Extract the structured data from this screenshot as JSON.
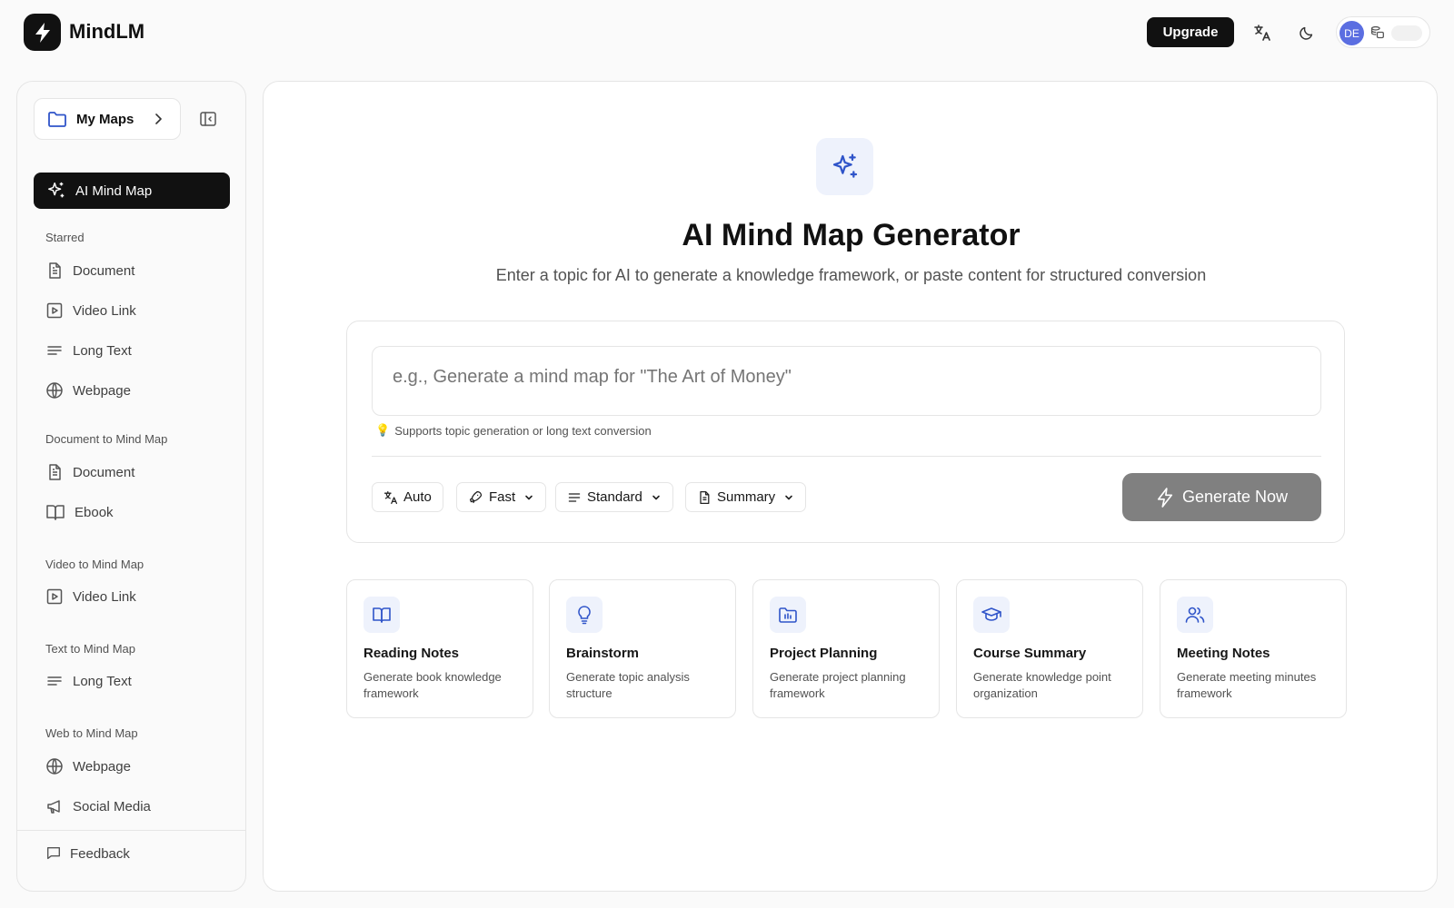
{
  "header": {
    "brand": "MindLM",
    "upgrade_label": "Upgrade",
    "avatar_initials": "DE"
  },
  "sidebar": {
    "my_maps_label": "My Maps",
    "active_item": "AI Mind Map",
    "sections": [
      {
        "label": "Starred",
        "items": [
          {
            "label": "Document",
            "icon": "document-icon"
          },
          {
            "label": "Video Link",
            "icon": "video-icon"
          },
          {
            "label": "Long Text",
            "icon": "text-lines-icon"
          },
          {
            "label": "Webpage",
            "icon": "globe-icon"
          }
        ]
      },
      {
        "label": "Document to Mind Map",
        "items": [
          {
            "label": "Document",
            "icon": "document-icon"
          },
          {
            "label": "Ebook",
            "icon": "book-icon"
          }
        ]
      },
      {
        "label": "Video to Mind Map",
        "items": [
          {
            "label": "Video Link",
            "icon": "video-icon"
          }
        ]
      },
      {
        "label": "Text to Mind Map",
        "items": [
          {
            "label": "Long Text",
            "icon": "text-lines-icon"
          }
        ]
      },
      {
        "label": "Web to Mind Map",
        "items": [
          {
            "label": "Webpage",
            "icon": "globe-icon"
          },
          {
            "label": "Social Media",
            "icon": "megaphone-icon"
          }
        ]
      }
    ],
    "feedback_label": "Feedback"
  },
  "main": {
    "title": "AI Mind Map Generator",
    "subtitle": "Enter a topic for AI to generate a knowledge framework, or paste content for structured conversion",
    "prompt_placeholder": "e.g., Generate a mind map for \"The Art of Money\"",
    "hint": "Supports topic generation or long text conversion",
    "options": {
      "language": "Auto",
      "speed": "Fast",
      "detail": "Standard",
      "mode": "Summary"
    },
    "generate_label": "Generate Now",
    "templates": [
      {
        "name": "Reading Notes",
        "desc": "Generate book knowledge framework",
        "icon": "open-book-icon"
      },
      {
        "name": "Brainstorm",
        "desc": "Generate topic analysis structure",
        "icon": "lightbulb-icon"
      },
      {
        "name": "Project Planning",
        "desc": "Generate project planning framework",
        "icon": "folder-chart-icon"
      },
      {
        "name": "Course Summary",
        "desc": "Generate knowledge point organization",
        "icon": "graduation-cap-icon"
      },
      {
        "name": "Meeting Notes",
        "desc": "Generate meeting minutes framework",
        "icon": "users-icon"
      }
    ]
  },
  "colors": {
    "accent_blue": "#2f54c9",
    "dark": "#111111",
    "generate_disabled": "#808080"
  }
}
